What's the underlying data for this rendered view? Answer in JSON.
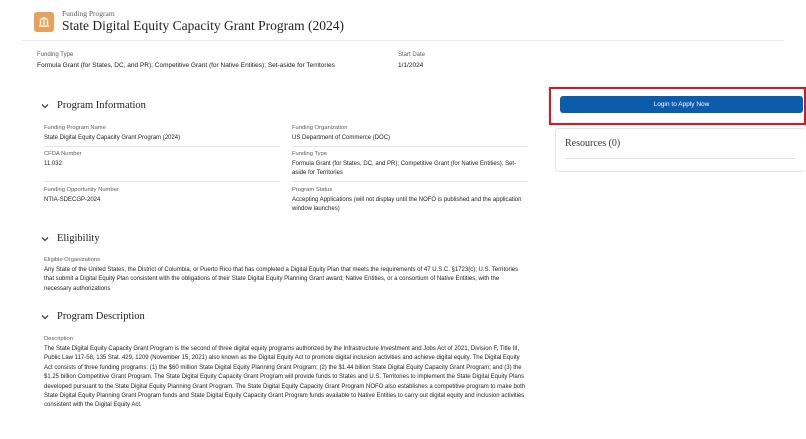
{
  "header": {
    "eyebrow": "Funding Program",
    "title": "State Digital Equity Capacity Grant Program (2024)",
    "icon": "bank-icon",
    "icon_color": "#e8a05a"
  },
  "summary": {
    "funding_type_label": "Funding Type",
    "funding_type_value": "Formula Grant (for States, DC, and PR); Competitive Grant (for Native Entities); Set-aside for Territories",
    "start_date_label": "Start Date",
    "start_date_value": "1/1/2024"
  },
  "program_information": {
    "title": "Program Information",
    "fields": {
      "name_label": "Funding Program Name",
      "name_value": "State Digital Equity Capacity Grant Program (2024)",
      "org_label": "Funding Organization",
      "org_value": "US Department of Commerce (DOC)",
      "cfda_label": "CFDA Number",
      "cfda_value": "11.032",
      "type_label": "Funding Type",
      "type_value": "Formula Grant (for States, DC, and PR); Competitive Grant (for Native Entities); Set-aside for Territories",
      "fon_label": "Funding Opportunity Number",
      "fon_value": "NTIA-SDECGP-2024",
      "status_label": "Program Status",
      "status_value": "Accepting Applications (will not display until the NOFO is published and the application window launches)"
    }
  },
  "eligibility": {
    "title": "Eligibility",
    "label": "Eligible Organizations",
    "value": "Any State of the United States, the District of Columbia, or Puerto Rico that has completed a Digital Equity Plan that meets the requirements of 47 U.S.C. §1723(c); U.S. Territories that submit a Digital Equity Plan consistent with the obligations of their State Digital Equity Planning Grant award; Native Entities, or a consortium of Native Entities, with the necessary authorizations"
  },
  "program_description": {
    "title": "Program Description",
    "label": "Description",
    "value": "The State Digital Equity Capacity Grant Program is the second of three digital equity programs authorized by the Infrastructure Investment and Jobs Act of 2021, Division F, Title III, Public Law 117-58, 135 Stat. 429, 1209 (November 15, 2021) also known as the Digital Equity Act to promote digital inclusion activities and achieve digital equity. The Digital Equity Act consists of three funding programs: (1) the $60 million State Digital Equity Planning Grant Program; (2) the $1.44 billion State Digital Equity Capacity Grant Program; and (3) the $1.25 billion Competitive Grant Program. The State Digital Equity Capacity Grant Program will provide funds to States and U.S. Territories to implement the State Digital Equity Plans developed pursuant to the State Digital Equity Planning Grant Program. The State Digital Equity Capacity Grant Program NOFO also establishes a competitive program to make both State Digital Equity Planning Grant Program funds and State Digital Equity Capacity Grant Program funds available to Native Entities to carry out digital equity and inclusion activities consistent with the Digital Equity Act."
  },
  "sidebar": {
    "apply_label": "Login to Apply Now",
    "resources_title": "Resources (0)"
  },
  "colors": {
    "primary_button": "#0b5cab",
    "highlight_border": "#e0141a"
  }
}
